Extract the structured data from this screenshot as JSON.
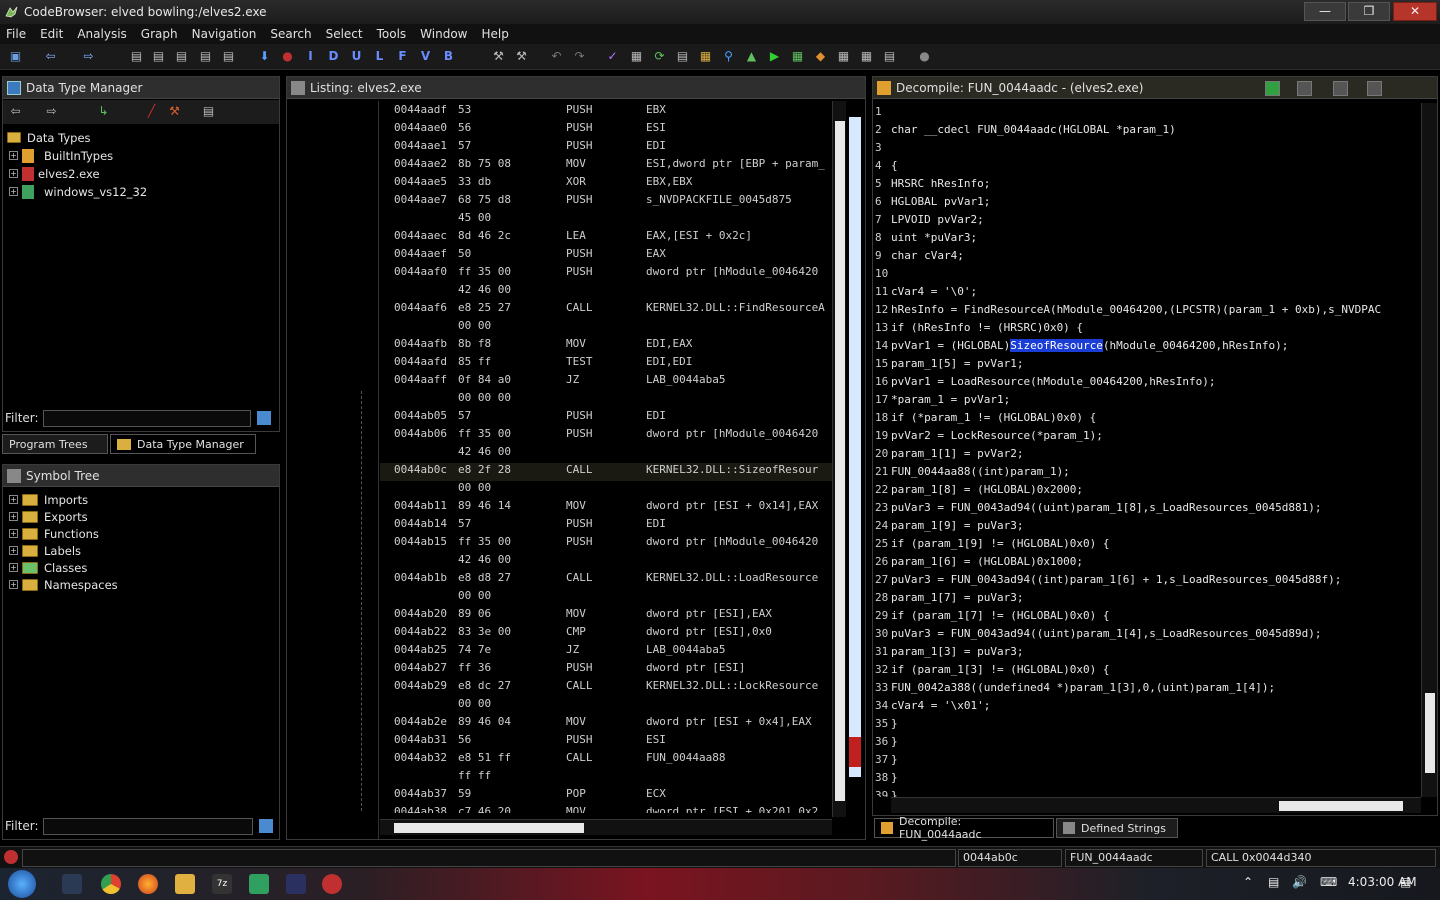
{
  "window": {
    "title": "CodeBrowser: elved bowling:/elves2.exe",
    "controls": {
      "minimize": "—",
      "maximize": "❒",
      "close": "✕"
    }
  },
  "menu": [
    "File",
    "Edit",
    "Analysis",
    "Graph",
    "Navigation",
    "Search",
    "Select",
    "Tools",
    "Window",
    "Help"
  ],
  "toolbar_letters": [
    "I",
    "D",
    "U",
    "L",
    "F",
    "V",
    "B"
  ],
  "data_type_manager": {
    "title": "Data Type Manager",
    "root": "Data Types",
    "items": [
      "BuiltInTypes",
      "elves2.exe",
      "windows_vs12_32"
    ],
    "filter_label": "Filter:"
  },
  "bottom_tabs_left": {
    "program_trees": "Program Trees",
    "data_type_manager": "Data Type Manager"
  },
  "symbol_tree": {
    "title": "Symbol Tree",
    "items": [
      "Imports",
      "Exports",
      "Functions",
      "Labels",
      "Classes",
      "Namespaces"
    ],
    "filter_label": "Filter:"
  },
  "listing": {
    "title": "Listing:  elves2.exe",
    "rows": [
      {
        "addr": "0044aadf",
        "bytes": "53",
        "mnem": "PUSH",
        "ops": "EBX"
      },
      {
        "addr": "0044aae0",
        "bytes": "56",
        "mnem": "PUSH",
        "ops": "ESI"
      },
      {
        "addr": "0044aae1",
        "bytes": "57",
        "mnem": "PUSH",
        "ops": "EDI"
      },
      {
        "addr": "0044aae2",
        "bytes": "8b 75 08",
        "mnem": "MOV",
        "ops": "ESI,dword ptr [EBP + param_"
      },
      {
        "addr": "0044aae5",
        "bytes": "33 db",
        "mnem": "XOR",
        "ops": "EBX,EBX"
      },
      {
        "addr": "0044aae7",
        "bytes": "68 75 d8",
        "mnem": "PUSH",
        "ops": "s_NVDPACKFILE_0045d875"
      },
      {
        "addr": "",
        "bytes": "45 00",
        "mnem": "",
        "ops": ""
      },
      {
        "addr": "0044aaec",
        "bytes": "8d 46 2c",
        "mnem": "LEA",
        "ops": "EAX,[ESI + 0x2c]"
      },
      {
        "addr": "0044aaef",
        "bytes": "50",
        "mnem": "PUSH",
        "ops": "EAX"
      },
      {
        "addr": "0044aaf0",
        "bytes": "ff 35 00",
        "mnem": "PUSH",
        "ops": "dword ptr [hModule_0046420"
      },
      {
        "addr": "",
        "bytes": "42 46 00",
        "mnem": "",
        "ops": ""
      },
      {
        "addr": "0044aaf6",
        "bytes": "e8 25 27",
        "mnem": "CALL",
        "ops": "KERNEL32.DLL::FindResourceA"
      },
      {
        "addr": "",
        "bytes": "00 00",
        "mnem": "",
        "ops": ""
      },
      {
        "addr": "0044aafb",
        "bytes": "8b f8",
        "mnem": "MOV",
        "ops": "EDI,EAX"
      },
      {
        "addr": "0044aafd",
        "bytes": "85 ff",
        "mnem": "TEST",
        "ops": "EDI,EDI"
      },
      {
        "addr": "0044aaff",
        "bytes": "0f 84 a0",
        "mnem": "JZ",
        "ops": "LAB_0044aba5"
      },
      {
        "addr": "",
        "bytes": "00 00 00",
        "mnem": "",
        "ops": ""
      },
      {
        "addr": "0044ab05",
        "bytes": "57",
        "mnem": "PUSH",
        "ops": "EDI"
      },
      {
        "addr": "0044ab06",
        "bytes": "ff 35 00",
        "mnem": "PUSH",
        "ops": "dword ptr [hModule_0046420"
      },
      {
        "addr": "",
        "bytes": "42 46 00",
        "mnem": "",
        "ops": ""
      },
      {
        "addr": "0044ab0c",
        "bytes": "e8 2f 28",
        "mnem": "CALL",
        "ops": "KERNEL32.DLL::SizeofResour"
      },
      {
        "addr": "",
        "bytes": "00 00",
        "mnem": "",
        "ops": ""
      },
      {
        "addr": "0044ab11",
        "bytes": "89 46 14",
        "mnem": "MOV",
        "ops": "dword ptr [ESI + 0x14],EAX"
      },
      {
        "addr": "0044ab14",
        "bytes": "57",
        "mnem": "PUSH",
        "ops": "EDI"
      },
      {
        "addr": "0044ab15",
        "bytes": "ff 35 00",
        "mnem": "PUSH",
        "ops": "dword ptr [hModule_0046420"
      },
      {
        "addr": "",
        "bytes": "42 46 00",
        "mnem": "",
        "ops": ""
      },
      {
        "addr": "0044ab1b",
        "bytes": "e8 d8 27",
        "mnem": "CALL",
        "ops": "KERNEL32.DLL::LoadResource"
      },
      {
        "addr": "",
        "bytes": "00 00",
        "mnem": "",
        "ops": ""
      },
      {
        "addr": "0044ab20",
        "bytes": "89 06",
        "mnem": "MOV",
        "ops": "dword ptr [ESI],EAX"
      },
      {
        "addr": "0044ab22",
        "bytes": "83 3e 00",
        "mnem": "CMP",
        "ops": "dword ptr [ESI],0x0"
      },
      {
        "addr": "0044ab25",
        "bytes": "74 7e",
        "mnem": "JZ",
        "ops": "LAB_0044aba5"
      },
      {
        "addr": "0044ab27",
        "bytes": "ff 36",
        "mnem": "PUSH",
        "ops": "dword ptr [ESI]"
      },
      {
        "addr": "0044ab29",
        "bytes": "e8 dc 27",
        "mnem": "CALL",
        "ops": "KERNEL32.DLL::LockResource"
      },
      {
        "addr": "",
        "bytes": "00 00",
        "mnem": "",
        "ops": ""
      },
      {
        "addr": "0044ab2e",
        "bytes": "89 46 04",
        "mnem": "MOV",
        "ops": "dword ptr [ESI + 0x4],EAX"
      },
      {
        "addr": "0044ab31",
        "bytes": "56",
        "mnem": "PUSH",
        "ops": "ESI"
      },
      {
        "addr": "0044ab32",
        "bytes": "e8 51 ff",
        "mnem": "CALL",
        "ops": "FUN_0044aa88"
      },
      {
        "addr": "",
        "bytes": "ff ff",
        "mnem": "",
        "ops": ""
      },
      {
        "addr": "0044ab37",
        "bytes": "59",
        "mnem": "POP",
        "ops": "ECX"
      },
      {
        "addr": "0044ab38",
        "bytes": "c7 46 20",
        "mnem": "MOV",
        "ops": "dword ptr [ESI + 0x20],0x2"
      }
    ]
  },
  "decompile": {
    "title": "Decompile: FUN_0044aadc  - (elves2.exe)",
    "lines": [
      "",
      "char __cdecl FUN_0044aadc(HGLOBAL *param_1)",
      "",
      "{",
      "  HRSRC hResInfo;",
      "  HGLOBAL pvVar1;",
      "  LPVOID pvVar2;",
      "  uint *puVar3;",
      "  char cVar4;",
      "",
      "  cVar4 = '\\0';",
      "  hResInfo = FindResourceA(hModule_00464200,(LPCSTR)(param_1 + 0xb),s_NVDPAC",
      "  if (hResInfo != (HRSRC)0x0) {",
      "    pvVar1 = (HGLOBAL)SizeofResource(hModule_00464200,hResInfo);",
      "    param_1[5] = pvVar1;",
      "    pvVar1 = LoadResource(hModule_00464200,hResInfo);",
      "    *param_1 = pvVar1;",
      "    if (*param_1 != (HGLOBAL)0x0) {",
      "      pvVar2 = LockResource(*param_1);",
      "      param_1[1] = pvVar2;",
      "      FUN_0044aa88((int)param_1);",
      "      param_1[8] = (HGLOBAL)0x2000;",
      "      puVar3 = FUN_0043ad94((uint)param_1[8],s_LoadResources_0045d881);",
      "      param_1[9] = puVar3;",
      "      if (param_1[9] != (HGLOBAL)0x0) {",
      "        param_1[6] = (HGLOBAL)0x1000;",
      "        puVar3 = FUN_0043ad94((int)param_1[6] + 1,s_LoadResources_0045d88f);",
      "        param_1[7] = puVar3;",
      "        if (param_1[7] != (HGLOBAL)0x0) {",
      "          puVar3 = FUN_0043ad94((uint)param_1[4],s_LoadResources_0045d89d);",
      "          param_1[3] = puVar3;",
      "          if (param_1[3] != (HGLOBAL)0x0) {",
      "            FUN_0042a388((undefined4 *)param_1[3],0,(uint)param_1[4]);",
      "            cVar4 = '\\x01';",
      "          }",
      "        }",
      "      }",
      "    }",
      "  }"
    ]
  },
  "bottom_tabs_right": {
    "decompile": "Decompile: FUN_0044aadc",
    "defined_strings": "Defined Strings"
  },
  "status": {
    "address": "0044ab0c",
    "function": "FUN_0044aadc",
    "instruction": "CALL 0x0044d340"
  },
  "taskbar": {
    "time": "4:03:00 AM"
  },
  "colors": {
    "keyword": "#c8c8c8",
    "variable": "#a78bfa",
    "string": "#9a9aff",
    "highlight": "#1a3dd6"
  }
}
